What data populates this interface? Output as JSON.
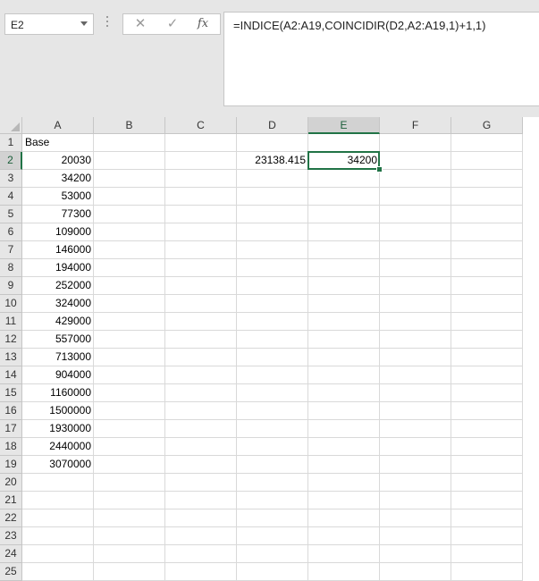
{
  "name_box": {
    "value": "E2"
  },
  "formula_bar": {
    "cancel_icon": "✕",
    "enter_icon": "✓",
    "fx_label": "fx",
    "formula": "=INDICE(A2:A19,COINCIDIR(D2,A2:A19,1)+1,1)"
  },
  "sheet": {
    "columns": [
      "A",
      "B",
      "C",
      "D",
      "E",
      "F",
      "G"
    ],
    "selected_column": "E",
    "selected_row": 2,
    "rows": [
      {
        "n": "1",
        "A": "Base",
        "D": "",
        "E": ""
      },
      {
        "n": "2",
        "A": "20030",
        "D": "23138.415",
        "E": "34200"
      },
      {
        "n": "3",
        "A": "34200"
      },
      {
        "n": "4",
        "A": "53000"
      },
      {
        "n": "5",
        "A": "77300"
      },
      {
        "n": "6",
        "A": "109000"
      },
      {
        "n": "7",
        "A": "146000"
      },
      {
        "n": "8",
        "A": "194000"
      },
      {
        "n": "9",
        "A": "252000"
      },
      {
        "n": "10",
        "A": "324000"
      },
      {
        "n": "11",
        "A": "429000"
      },
      {
        "n": "12",
        "A": "557000"
      },
      {
        "n": "13",
        "A": "713000"
      },
      {
        "n": "14",
        "A": "904000"
      },
      {
        "n": "15",
        "A": "1160000"
      },
      {
        "n": "16",
        "A": "1500000"
      },
      {
        "n": "17",
        "A": "1930000"
      },
      {
        "n": "18",
        "A": "2440000"
      },
      {
        "n": "19",
        "A": "3070000"
      },
      {
        "n": "20"
      },
      {
        "n": "21"
      },
      {
        "n": "22"
      },
      {
        "n": "23"
      },
      {
        "n": "24"
      },
      {
        "n": "25"
      }
    ]
  },
  "colors": {
    "accent": "#217346",
    "header_bg": "#e6e6e6"
  }
}
